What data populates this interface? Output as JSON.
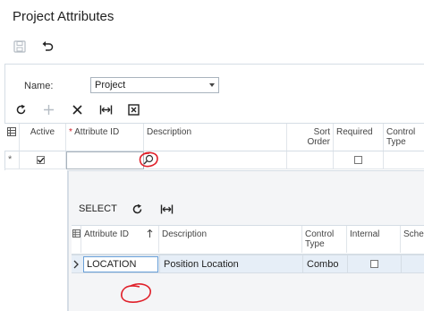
{
  "page": {
    "title": "Project Attributes"
  },
  "toolbar": {
    "save_icon": "save-icon",
    "undo_icon": "undo-icon"
  },
  "form": {
    "name_label": "Name:",
    "name_value": "Project"
  },
  "top_grid": {
    "columns": {
      "active": "Active",
      "required_marker": "*",
      "attribute_id": "Attribute ID",
      "description": "Description",
      "sort_order": "Sort Order",
      "required": "Required",
      "control_type": "Control Type"
    },
    "new_row_marker": "*"
  },
  "lower_toolbar": {
    "select_label": "SELECT"
  },
  "lower_grid": {
    "columns": {
      "attribute_id": "Attribute ID",
      "description": "Description",
      "control_type": "Control Type",
      "internal": "Internal",
      "schema": "Schem"
    },
    "rows": [
      {
        "attribute_id": "LOCATION",
        "description": "Position Location",
        "control_type": "Combo",
        "internal": false
      }
    ]
  },
  "colors": {
    "annotation": "#e0202a",
    "selected_row": "#e6eef7",
    "border": "#d5dde5"
  }
}
